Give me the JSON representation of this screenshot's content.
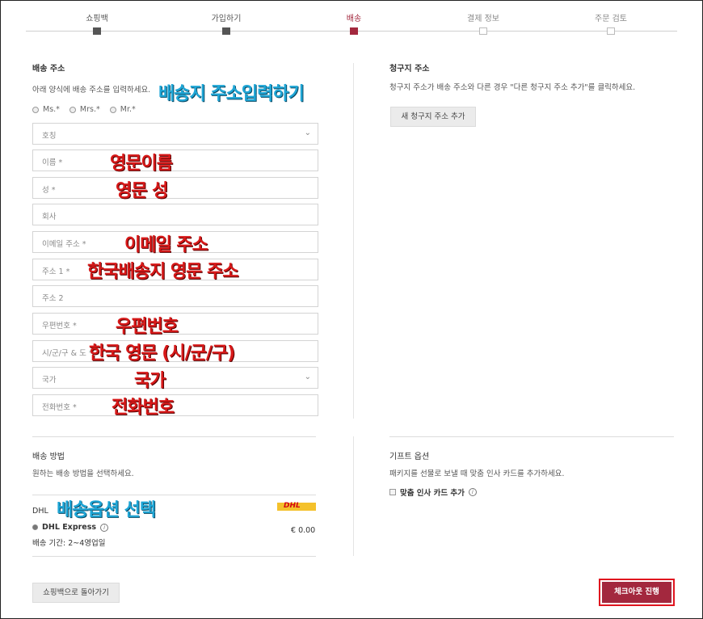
{
  "steps": [
    {
      "label": "쇼핑백",
      "state": "done"
    },
    {
      "label": "가입하기",
      "state": "done"
    },
    {
      "label": "배송",
      "state": "active"
    },
    {
      "label": "결제 정보",
      "state": "todo"
    },
    {
      "label": "주문 검토",
      "state": "todo"
    }
  ],
  "shipping": {
    "title": "배송 주소",
    "intro": "아래 양식에 배송 주소를 입력하세요.",
    "annotation": "배송지 주소입력하기",
    "salutations": [
      "Ms.*",
      "Mrs.*",
      "Mr.*"
    ],
    "fields": {
      "title": "호칭",
      "first_name": "이름 *",
      "last_name": "성 *",
      "company": "회사",
      "email": "이메일 주소 *",
      "address1": "주소 1 *",
      "address2": "주소 2",
      "postal": "우편번호 *",
      "city": "시/군/구 & 도 *",
      "country": "국가",
      "phone": "전화번호 *"
    },
    "annotations": {
      "first_name": "영문이름",
      "last_name": "영문 성",
      "email": "이메일 주소",
      "address1": "한국배송지 영문 주소",
      "postal": "우편번호",
      "city": "한국 영문 (시/군/구)",
      "country": "국가",
      "phone": "전화번호"
    }
  },
  "billing": {
    "title": "청구지 주소",
    "intro": "청구지 주소가 배송 주소와 다른 경우 \"다른 청구지 주소 추가\"를 클릭하세요.",
    "add_button": "새 청구지 주소 추가"
  },
  "method": {
    "title": "배송 방법",
    "intro": "원하는 배송 방법을 선택하세요.",
    "carrier": "DHL",
    "annotation": "배송옵션 선택",
    "logo_text": "DHL",
    "option_name": "DHL Express",
    "option_price": "€ 0.00",
    "option_duration": "배송 기간: 2~4영업일"
  },
  "gift": {
    "title": "기프트 옵션",
    "intro": "패키지를 선물로 보낼 때 맞춤 인사 카드를 추가하세요.",
    "checkbox_label": "맞춤 인사 카드 추가"
  },
  "footer": {
    "back_button": "쇼핑백으로 돌아가기",
    "checkout_button": "체크아웃 진행"
  },
  "colors": {
    "accent": "#a3283e",
    "annotation_red": "#d71919",
    "annotation_blue": "#1fa6d6",
    "dhl_yellow": "#f4c12b",
    "dhl_red": "#d40511"
  }
}
